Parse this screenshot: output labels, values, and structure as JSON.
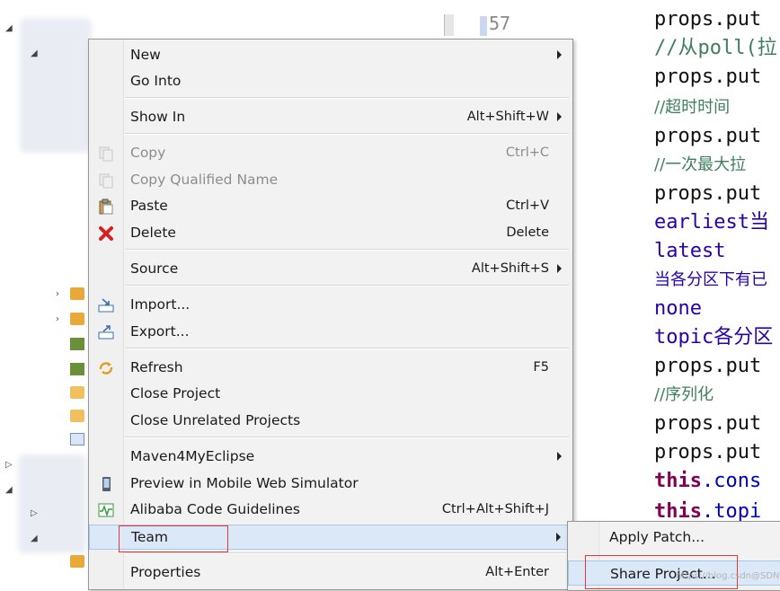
{
  "menu": {
    "items": [
      {
        "key": "new",
        "label": "New",
        "accel": "",
        "submenu": true,
        "disabled": false,
        "icon": "none"
      },
      {
        "key": "go-into",
        "label": "Go Into",
        "accel": "",
        "submenu": false,
        "disabled": false,
        "icon": "none"
      },
      {
        "key": "show-in",
        "label": "Show In",
        "accel": "Alt+Shift+W",
        "submenu": true,
        "disabled": false,
        "icon": "none"
      },
      {
        "key": "copy",
        "label": "Copy",
        "accel": "Ctrl+C",
        "submenu": false,
        "disabled": true,
        "icon": "copy-icon"
      },
      {
        "key": "copy-qualified",
        "label": "Copy Qualified Name",
        "accel": "",
        "submenu": false,
        "disabled": true,
        "icon": "copy-icon"
      },
      {
        "key": "paste",
        "label": "Paste",
        "accel": "Ctrl+V",
        "submenu": false,
        "disabled": false,
        "icon": "paste-icon"
      },
      {
        "key": "delete",
        "label": "Delete",
        "accel": "Delete",
        "submenu": false,
        "disabled": false,
        "icon": "delete-icon"
      },
      {
        "key": "source",
        "label": "Source",
        "accel": "Alt+Shift+S",
        "submenu": true,
        "disabled": false,
        "icon": "none"
      },
      {
        "key": "import",
        "label": "Import...",
        "accel": "",
        "submenu": false,
        "disabled": false,
        "icon": "import-icon"
      },
      {
        "key": "export",
        "label": "Export...",
        "accel": "",
        "submenu": false,
        "disabled": false,
        "icon": "export-icon"
      },
      {
        "key": "refresh",
        "label": "Refresh",
        "accel": "F5",
        "submenu": false,
        "disabled": false,
        "icon": "refresh-icon"
      },
      {
        "key": "close-project",
        "label": "Close Project",
        "accel": "",
        "submenu": false,
        "disabled": false,
        "icon": "none"
      },
      {
        "key": "close-unrelated",
        "label": "Close Unrelated Projects",
        "accel": "",
        "submenu": false,
        "disabled": false,
        "icon": "none"
      },
      {
        "key": "maven",
        "label": "Maven4MyEclipse",
        "accel": "",
        "submenu": true,
        "disabled": false,
        "icon": "none"
      },
      {
        "key": "preview-mobile",
        "label": "Preview in Mobile Web Simulator",
        "accel": "",
        "submenu": false,
        "disabled": false,
        "icon": "mobile-icon"
      },
      {
        "key": "alibaba",
        "label": "Alibaba Code Guidelines",
        "accel": "Ctrl+Alt+Shift+J",
        "submenu": false,
        "disabled": false,
        "icon": "guidelines-icon"
      },
      {
        "key": "team",
        "label": "Team",
        "accel": "",
        "submenu": true,
        "disabled": false,
        "icon": "none"
      },
      {
        "key": "properties",
        "label": "Properties",
        "accel": "Alt+Enter",
        "submenu": false,
        "disabled": false,
        "icon": "none"
      }
    ]
  },
  "submenu": {
    "items": [
      {
        "label": "Apply Patch..."
      },
      {
        "label": "Share Project..."
      }
    ]
  },
  "editor": {
    "gutter_number": "57",
    "lines": [
      {
        "text": "props.put",
        "style": "plain"
      },
      {
        "text": "//从poll(拉",
        "style": "comment"
      },
      {
        "text": "props.put",
        "style": "plain"
      },
      {
        "text": "//超时时间",
        "style": "comment-zh"
      },
      {
        "text": "props.put",
        "style": "plain"
      },
      {
        "text": "//一次最大拉",
        "style": "comment-zh"
      },
      {
        "text": "props.put",
        "style": "plain"
      },
      {
        "text": "earliest当",
        "style": "purple"
      },
      {
        "text": "latest",
        "style": "purple"
      },
      {
        "text": "当各分区下有已",
        "style": "zhtext"
      },
      {
        "text": "none",
        "style": "purple"
      },
      {
        "text": "topic各分区",
        "style": "purple"
      },
      {
        "text": "props.put",
        "style": "plain"
      },
      {
        "text": "//序列化",
        "style": "comment-zh"
      },
      {
        "text": "props.put",
        "style": "plain"
      },
      {
        "text": "props.put",
        "style": "plain"
      },
      {
        "text": "this.cons",
        "style": "this"
      },
      {
        "text": "this.topi",
        "style": "this"
      }
    ]
  },
  "watermark": "https://blog.csdn@SDN@Betty",
  "colors": {
    "menu_bg": "#f2f2f2",
    "highlight_bg": "#dbe8f7",
    "annotation_red": "#e53935",
    "comment_green": "#3f7f5f",
    "keyword_purple": "#7f0055"
  }
}
